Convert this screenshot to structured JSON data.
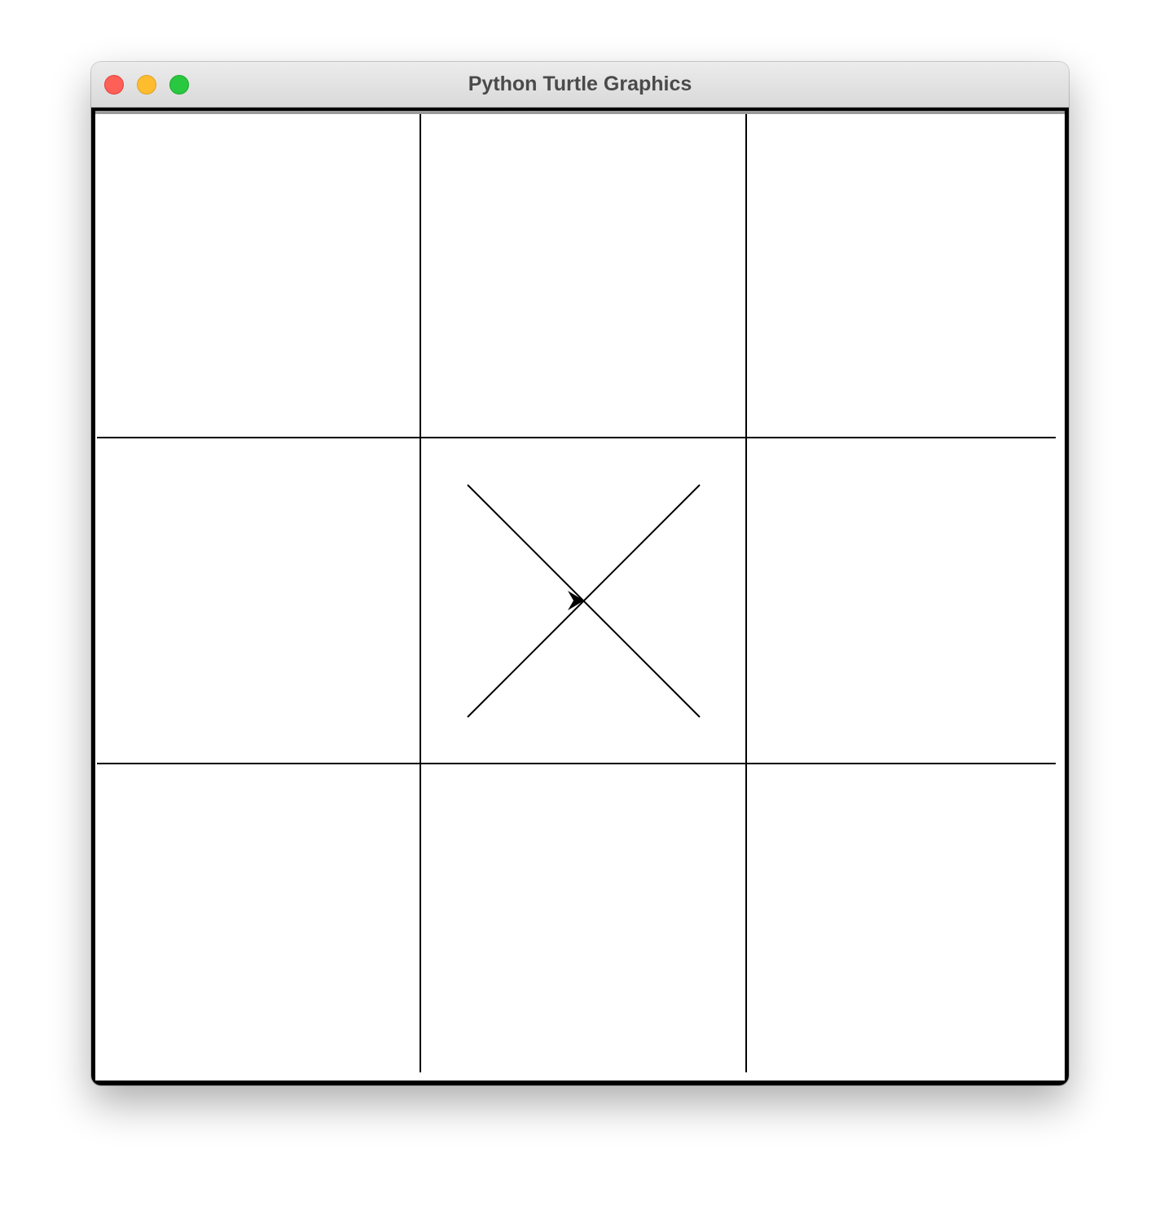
{
  "window": {
    "title": "Python Turtle Graphics"
  },
  "window_controls": [
    {
      "name": "close",
      "color": "#fe5f57"
    },
    {
      "name": "minimize",
      "color": "#febc2e"
    },
    {
      "name": "zoom",
      "color": "#28c840"
    }
  ],
  "board": {
    "rows": 3,
    "cols": 3,
    "line_color": "#000000",
    "background": "#ffffff",
    "cells": [
      [
        "",
        "",
        ""
      ],
      [
        "",
        "X",
        ""
      ],
      [
        "",
        "",
        ""
      ]
    ]
  },
  "turtle": {
    "shape": "classic-arrow",
    "heading": "east",
    "color": "#000000"
  }
}
